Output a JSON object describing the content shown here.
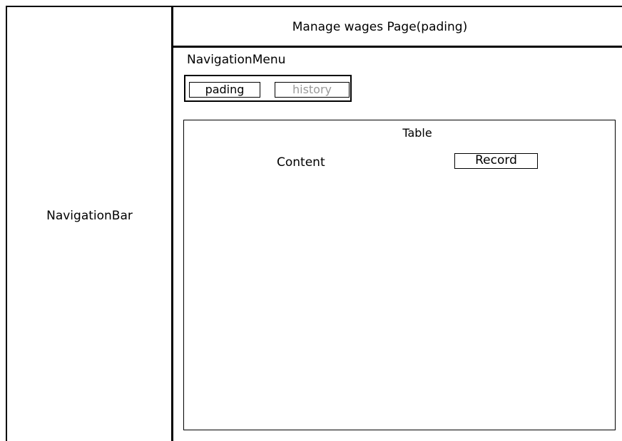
{
  "navigation_bar": {
    "label": "NavigationBar"
  },
  "header": {
    "title": "Manage wages Page(pading)"
  },
  "navigation_menu": {
    "label": "NavigationMenu",
    "tabs": [
      {
        "label": "pading",
        "active": true
      },
      {
        "label": "history",
        "active": false
      }
    ]
  },
  "table": {
    "title": "Table",
    "content_label": "Content",
    "record_label": "Record"
  },
  "colors": {
    "border": "#000000",
    "inactive_text": "#9a9a9a",
    "background": "#ffffff"
  }
}
